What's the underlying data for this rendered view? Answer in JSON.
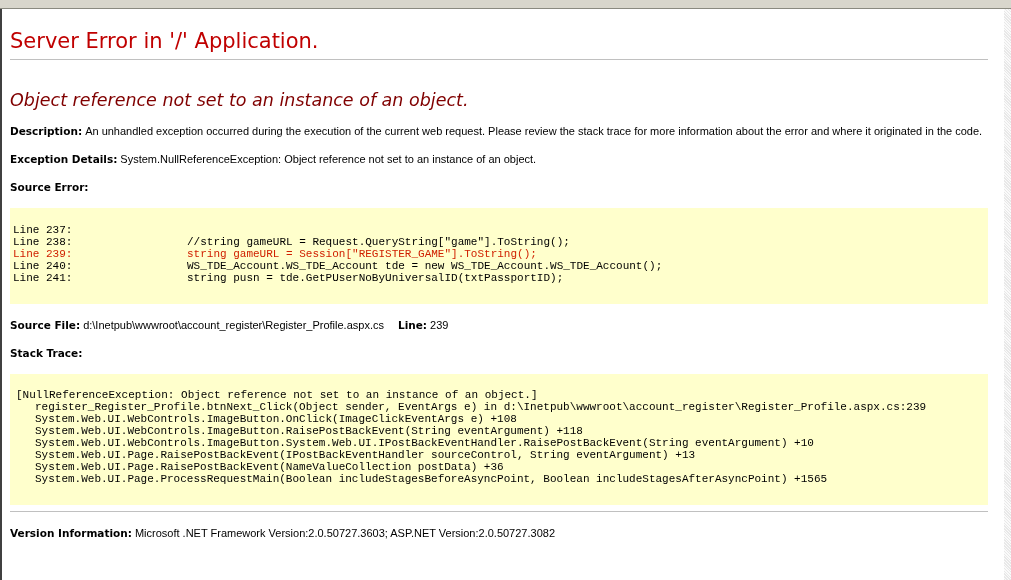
{
  "title": "Server Error in '/' Application.",
  "error_message": "Object reference not set to an instance of an object.",
  "description": {
    "label": "Description:",
    "text": "An unhandled exception occurred during the execution of the current web request. Please review the stack trace for more information about the error and where it originated in the code."
  },
  "exception_details": {
    "label": "Exception Details:",
    "text": "System.NullReferenceException: Object reference not set to an instance of an object."
  },
  "source_error": {
    "label": "Source Error:",
    "lines": [
      {
        "number": "Line 237:",
        "selected": false
      },
      {
        "number": "Line 238:",
        "code": "//string gameURL = Request.QueryString[\"game\"].ToString();",
        "selected": false
      },
      {
        "number": "Line 239:",
        "code": "string gameURL = Session[\"REGISTER_GAME\"].ToString();",
        "selected": true
      },
      {
        "number": "Line 240:",
        "code": "WS_TDE_Account.WS_TDE_Account tde = new WS_TDE_Account.WS_TDE_Account();",
        "selected": false
      },
      {
        "number": "Line 241:",
        "code": "string pusn = tde.GetPUserNoByUniversalID(txtPassportID);",
        "selected": false
      }
    ]
  },
  "source_file": {
    "label": "Source File:",
    "path": "d:\\Inetpub\\wwwroot\\account_register\\Register_Profile.aspx.cs",
    "line_label": "Line:",
    "line": "239"
  },
  "stack_trace": {
    "label": "Stack Trace:",
    "lines": [
      {
        "kind": "exception",
        "text": "[NullReferenceException: Object reference not set to an instance of an object.]"
      },
      {
        "kind": "frame",
        "text": "register_Register_Profile.btnNext_Click(Object sender, EventArgs e) in d:\\Inetpub\\wwwroot\\account_register\\Register_Profile.aspx.cs:239"
      },
      {
        "kind": "frame",
        "text": "System.Web.UI.WebControls.ImageButton.OnClick(ImageClickEventArgs e) +108"
      },
      {
        "kind": "frame",
        "text": "System.Web.UI.WebControls.ImageButton.RaisePostBackEvent(String eventArgument) +118"
      },
      {
        "kind": "frame",
        "text": "System.Web.UI.WebControls.ImageButton.System.Web.UI.IPostBackEventHandler.RaisePostBackEvent(String eventArgument) +10"
      },
      {
        "kind": "frame",
        "text": "System.Web.UI.Page.RaisePostBackEvent(IPostBackEventHandler sourceControl, String eventArgument) +13"
      },
      {
        "kind": "frame",
        "text": "System.Web.UI.Page.RaisePostBackEvent(NameValueCollection postData) +36"
      },
      {
        "kind": "frame",
        "text": "System.Web.UI.Page.ProcessRequestMain(Boolean includeStagesBeforeAsyncPoint, Boolean includeStagesAfterAsyncPoint) +1565"
      }
    ]
  },
  "version_info": {
    "label": "Version Information:",
    "text": "Microsoft .NET Framework Version:2.0.50727.3603; ASP.NET Version:2.0.50727.3082"
  }
}
